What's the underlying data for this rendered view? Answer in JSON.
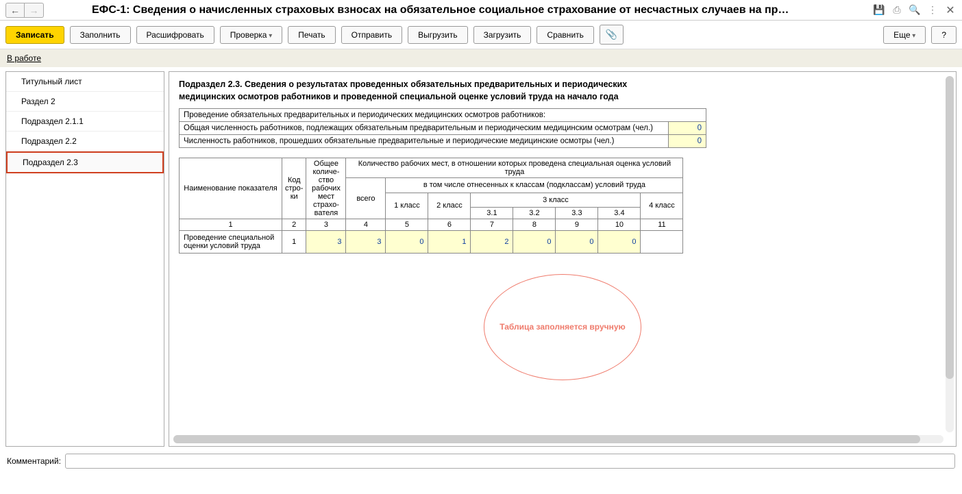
{
  "titlebar": {
    "title": "ЕФС-1: Сведения о начисленных страховых взносах на обязательное социальное страхование от несчастных случаев на пр…"
  },
  "toolbar": {
    "write": "Записать",
    "fill": "Заполнить",
    "decode": "Расшифровать",
    "check": "Проверка",
    "print": "Печать",
    "send": "Отправить",
    "export": "Выгрузить",
    "import": "Загрузить",
    "compare": "Сравнить",
    "more": "Еще",
    "help": "?"
  },
  "status": {
    "text": "В работе"
  },
  "sidebar": {
    "items": [
      {
        "label": "Титульный лист"
      },
      {
        "label": "Раздел 2"
      },
      {
        "label": "Подраздел 2.1.1"
      },
      {
        "label": "Подраздел 2.2"
      },
      {
        "label": "Подраздел 2.3"
      }
    ]
  },
  "section": {
    "heading": "Подраздел 2.3. Сведения о результатах проведенных обязательных предварительных и периодических медицинских осмотров работников и проведенной специальной оценке условий труда на начало года"
  },
  "table1": {
    "header": "Проведение обязательных предварительных и периодических медицинских осмотров работников:",
    "rows": [
      {
        "label": "Общая численность работников, подлежащих обязательным предварительным и периодическим медицинским осмотрам (чел.)",
        "value": "0"
      },
      {
        "label": "Численность работников, прошедших обязательные предварительные и периодические медицинские осмотры (чел.)",
        "value": "0"
      }
    ]
  },
  "table2": {
    "h_name": "Наименование показателя",
    "h_code": "Код стро-ки",
    "h_total_places": "Общее количе-ство рабочих мест страхо-вателя",
    "h_workplaces": "Количество рабочих мест, в отношении которых проведена специальная оценка условий труда",
    "h_all": "всего",
    "h_incl": "в том числе отнесенных к классам (подклассам) условий труда",
    "h_c1": "1 класс",
    "h_c2": "2 класс",
    "h_c3": "3 класс",
    "h_c4": "4 класс",
    "h_31": "3.1",
    "h_32": "3.2",
    "h_33": "3.3",
    "h_34": "3.4",
    "colnums": [
      "1",
      "2",
      "3",
      "4",
      "5",
      "6",
      "7",
      "8",
      "9",
      "10",
      "11"
    ],
    "row": {
      "name": "Проведение специальной оценки условий труда",
      "code": "1",
      "vals": [
        "3",
        "3",
        "0",
        "1",
        "2",
        "0",
        "0",
        "0"
      ]
    }
  },
  "annotation": {
    "text": "Таблица заполняется вручную"
  },
  "comment": {
    "label": "Комментарий:",
    "value": ""
  }
}
